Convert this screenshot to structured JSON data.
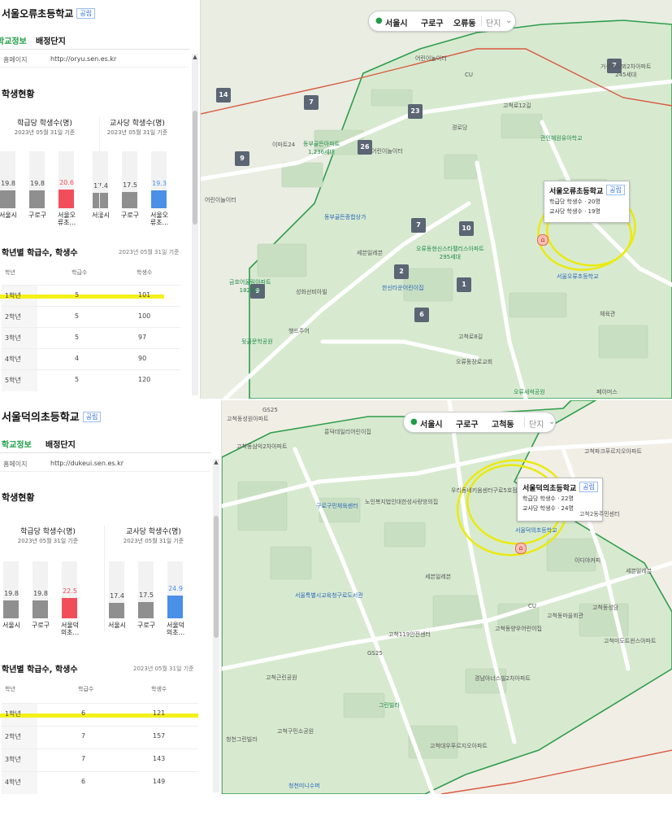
{
  "screens": [
    {
      "school_name": "서울오류초등학교",
      "badge": "공립",
      "tabs": [
        "학교정보",
        "배정단지"
      ],
      "homepage_label": "홈페이지",
      "homepage_url": "http://oryu.sen.es.kr",
      "section_title": "학생현황",
      "charts": [
        {
          "title": "학급당 학생수(명)",
          "date": "2023년 05월 31일 기준",
          "bars": [
            {
              "label": "서울시",
              "value": 19.8,
              "color": "#8f8f8f"
            },
            {
              "label": "구로구",
              "value": 19.8,
              "color": "#8f8f8f"
            },
            {
              "label": "서울오\n류초...",
              "value": 20.6,
              "color": "#f24e5a"
            }
          ]
        },
        {
          "title": "교사당 학생수(명)",
          "date": "2023년 05월 31일 기준",
          "bars": [
            {
              "label": "서울시",
              "value": 17.4,
              "color": "#8f8f8f"
            },
            {
              "label": "구로구",
              "value": 17.5,
              "color": "#8f8f8f"
            },
            {
              "label": "서울오\n류초...",
              "value": 19.3,
              "color": "#4a8fe8"
            }
          ]
        }
      ],
      "grade_title": "학년별 학급수, 학생수",
      "grade_date": "2023년 05월 31일 기준",
      "table_headers": [
        "학년",
        "학급수",
        "학생수"
      ],
      "rows": [
        {
          "grade": "1학년",
          "classes": "5",
          "students": "101"
        },
        {
          "grade": "2학년",
          "classes": "5",
          "students": "100"
        },
        {
          "grade": "3학년",
          "classes": "5",
          "students": "97"
        },
        {
          "grade": "4학년",
          "classes": "4",
          "students": "90"
        },
        {
          "grade": "5학년",
          "classes": "5",
          "students": "120"
        }
      ],
      "location": {
        "city": "서울시",
        "district": "구로구",
        "dong": "오류동",
        "filter": "단지"
      },
      "popup": {
        "name": "서울오류초등학교",
        "tag": "공립",
        "line1": "학급당 학생수 · 20명",
        "line2": "교사당 학생수 · 19명"
      },
      "markers": [
        "14",
        "7",
        "23",
        "26",
        "9",
        "7",
        "10",
        "2",
        "1",
        "6",
        "9",
        "7"
      ],
      "map_labels": [
        "어린이놀이터",
        "CU",
        "경로당",
        "이마트24",
        "동부골든아파트\n1,236세대",
        "어린이놀이터",
        "관인혜원유아학교",
        "고척로12길",
        "어린이놀이터",
        "동부골든종합상가",
        "세븐일레븐",
        "오류동현신스타팰리스아파트\n295세대",
        "금호어울림아파트\n182세대",
        "성화선비아빌",
        "한신타운어린이집",
        "서울오류초등학교",
        "체육관",
        "햇드주어",
        "뒷골문학공원",
        "고척로8길",
        "오류동장로교회",
        "오류새싹공원",
        "페이머스",
        "거성푸르뫼2차아파트\n245세대"
      ]
    },
    {
      "school_name": "서울덕의초등학교",
      "badge": "공립",
      "tabs": [
        "학교정보",
        "배정단지"
      ],
      "homepage_label": "홈페이지",
      "homepage_url": "http://dukeui.sen.es.kr",
      "section_title": "학생현황",
      "charts": [
        {
          "title": "학급당 학생수(명)",
          "date": "2023년 05월 31일 기준",
          "bars": [
            {
              "label": "서울시",
              "value": 19.8,
              "color": "#8f8f8f"
            },
            {
              "label": "구로구",
              "value": 19.8,
              "color": "#8f8f8f"
            },
            {
              "label": "서울덕\n의초...",
              "value": 22.5,
              "color": "#f24e5a"
            }
          ]
        },
        {
          "title": "교사당 학생수(명)",
          "date": "2023년 05월 31일 기준",
          "bars": [
            {
              "label": "서울시",
              "value": 17.4,
              "color": "#8f8f8f"
            },
            {
              "label": "구로구",
              "value": 17.5,
              "color": "#8f8f8f"
            },
            {
              "label": "서울덕\n의초...",
              "value": 24.9,
              "color": "#4a8fe8"
            }
          ]
        }
      ],
      "grade_title": "학년별 학급수, 학생수",
      "grade_date": "2023년 05월 31일 기준",
      "table_headers": [
        "학년",
        "학급수",
        "학생수"
      ],
      "rows": [
        {
          "grade": "1학년",
          "classes": "6",
          "students": "121"
        },
        {
          "grade": "2학년",
          "classes": "7",
          "students": "157"
        },
        {
          "grade": "3학년",
          "classes": "7",
          "students": "143"
        },
        {
          "grade": "4학년",
          "classes": "6",
          "students": "149"
        }
      ],
      "location": {
        "city": "서울시",
        "district": "구로구",
        "dong": "고척동",
        "filter": "단지"
      },
      "popup": {
        "name": "서울덕의초등학교",
        "tag": "공립",
        "line1": "학급당 학생수 · 22명",
        "line2": "교사당 학생수 · 24명"
      },
      "map_labels": [
        "GS25",
        "고척동성원아파트",
        "고척동삼익2차아파트",
        "흥덕데일리어린이집",
        "고척파크푸르지오아파트",
        "구로구민체육센터",
        "고척2동주민센터",
        "세븐일레븐",
        "노인복지법인대한성사랑방의집",
        "우리동네키움센터구로5호점",
        "서울특별시교육청구로도서관",
        "서울덕의초등학교",
        "이디야커피",
        "세븐일레븐",
        "CU",
        "고척119안전센터",
        "고척동양우어린이집",
        "고척동마을회관",
        "고척동성당",
        "고척미도트윈스아파트",
        "GS25",
        "고척근린공원",
        "경남아너스빌2차아파트",
        "고척대우푸르지오아파트",
        "청천그린빌라",
        "고척구민소공원",
        "그린빌라",
        "청천미니수퍼"
      ]
    }
  ]
}
